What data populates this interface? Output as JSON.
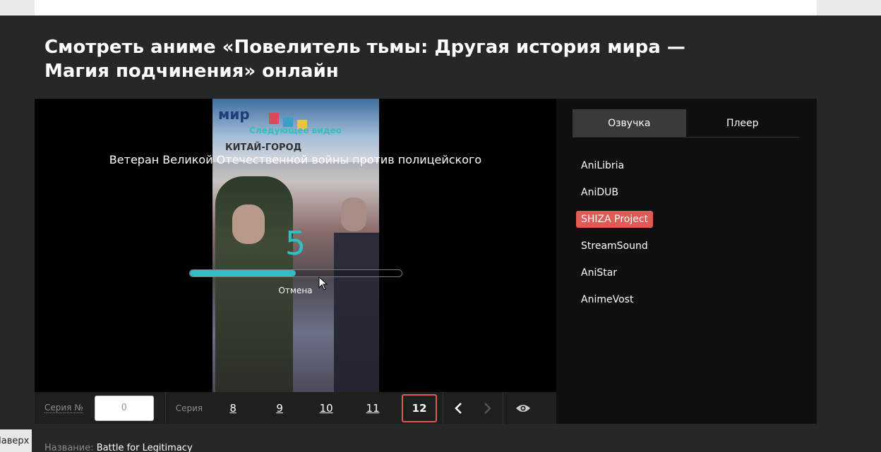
{
  "page_title": "Смотреть аниме «Повелитель тьмы: Другая история мира — Магия подчинения» онлайн",
  "player": {
    "next_label": "Следующее видео",
    "next_title": "Ветеран Великой Отечественной войны против полицейского",
    "countdown": "5",
    "progress": 0.5,
    "cancel_label": "Отмена",
    "video_sign_word": "мир",
    "video_sign_word2": "КИТАЙ-ГОРОД"
  },
  "controls": {
    "episode_number_label": "Серия №",
    "episode_input_placeholder": "0",
    "episode_label": "Серия",
    "episodes": [
      "8",
      "9",
      "10",
      "11",
      "12"
    ],
    "active_episode": "12"
  },
  "side_panel": {
    "tabs": [
      {
        "label": "Озвучка",
        "active": true
      },
      {
        "label": "Плеер",
        "active": false
      }
    ],
    "voices": [
      {
        "label": "AniLibria",
        "active": false
      },
      {
        "label": "AniDUB",
        "active": false
      },
      {
        "label": "SHIZA Project",
        "active": true
      },
      {
        "label": "StreamSound",
        "active": false
      },
      {
        "label": "AniStar",
        "active": false
      },
      {
        "label": "AnimeVost",
        "active": false
      }
    ]
  },
  "to_top_label": "Наверх",
  "info": {
    "name_label": "Название:",
    "name_value": "Battle for Legitimacy"
  },
  "colors": {
    "accent_teal": "#2fbfc2",
    "active_red": "#e15a55",
    "background": "#262727"
  }
}
